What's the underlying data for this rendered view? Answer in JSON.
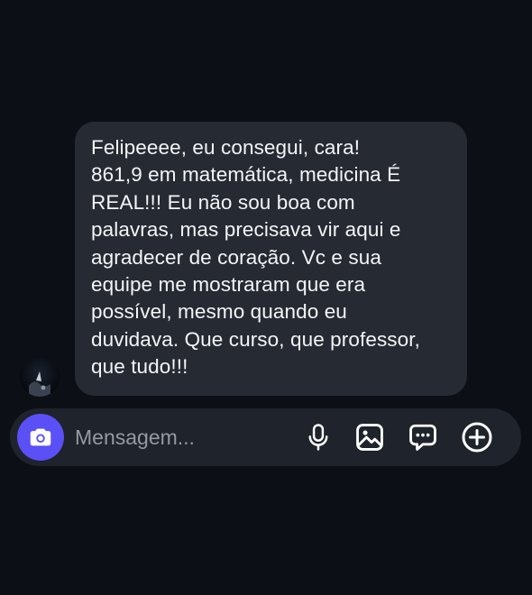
{
  "conversation": {
    "message": {
      "text": "Felipeeee, eu consegui, cara!\n861,9 em matemática, medicina É\nREAL!!! Eu não sou boa com\npalavras, mas precisava vir aqui e\nagradecer de coração. Vc e sua\nequipe me mostraram que era\npossível, mesmo quando eu\nduvidava. Que curso, que professor,\nque tudo!!!"
    }
  },
  "composer": {
    "placeholder": "Mensagem...",
    "value": "",
    "icons": {
      "camera": "camera-icon",
      "microphone": "microphone-icon",
      "gallery": "image-icon",
      "sticker": "chat-bubble-icon",
      "more": "plus-circle-icon"
    },
    "colors": {
      "camera_button": "#5a50f5",
      "composer_background": "#1f232b",
      "bubble_background": "#262a33",
      "page_background": "#0c0f16"
    }
  }
}
